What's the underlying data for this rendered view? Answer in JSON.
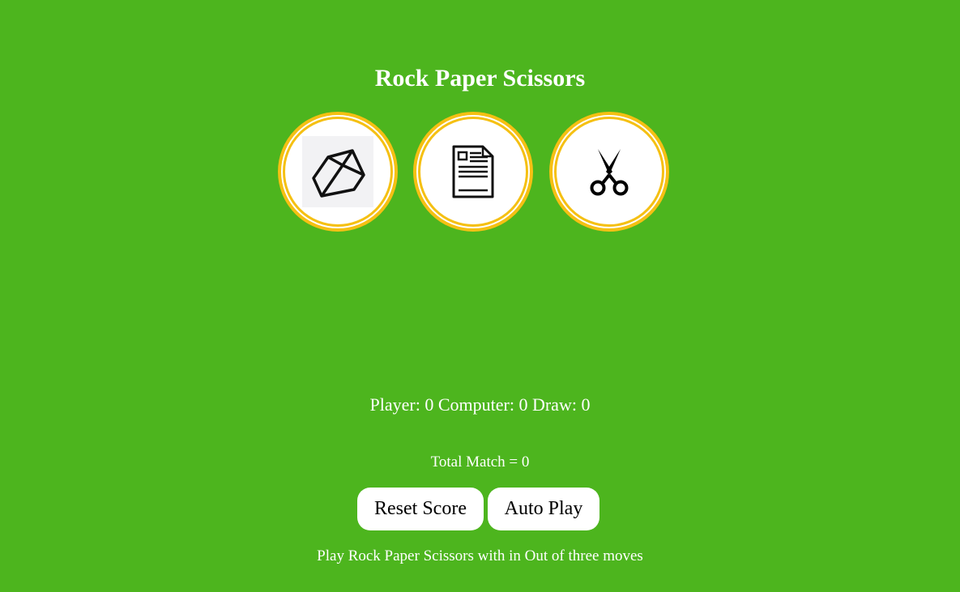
{
  "page": {
    "title": "Rock Paper Scissors"
  },
  "choices": [
    {
      "name": "rock",
      "icon": "rock-icon"
    },
    {
      "name": "paper",
      "icon": "paper-document-icon"
    },
    {
      "name": "scissors",
      "icon": "scissors-icon"
    }
  ],
  "scoreboard": {
    "text": "Player: 0 Computer: 0 Draw: 0",
    "player": 0,
    "computer": 0,
    "draw": 0
  },
  "total": {
    "text": "Total Match = 0",
    "value": 0
  },
  "buttons": {
    "reset_label": "Reset Score",
    "auto_label": "Auto Play"
  },
  "footer": {
    "text": "Play Rock Paper Scissors with in Out of three moves"
  },
  "colors": {
    "background": "#4db51e",
    "ring": "#f5c013",
    "button_bg": "#ffffff",
    "text": "#ffffff"
  }
}
